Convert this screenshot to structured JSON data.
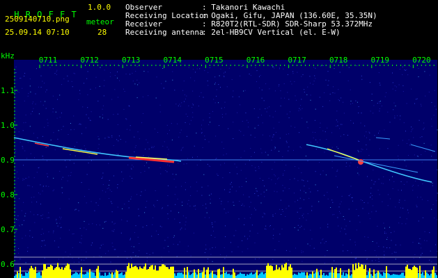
{
  "app": {
    "name": "H R O F F T",
    "version": "1.0.0",
    "filename": "2509140710.png",
    "datetime": "25.09.14 07:10",
    "meteor_label": "meteor",
    "meteor_count": "28"
  },
  "info": [
    {
      "label": "Observer",
      "value": ": Takanori Kawachi"
    },
    {
      "label": "Receiving Location",
      "value": ": Ogaki, Gifu, JAPAN (136.60E, 35.35N)"
    },
    {
      "label": "Receiver",
      "value": ": R820T2(RTL-SDR) SDR-Sharp 53.372MHz"
    },
    {
      "label": "Receiving antenna",
      "value": ": 2el-HB9CV Vertical (el. E-W)"
    }
  ],
  "chart_data": {
    "type": "heatmap",
    "ylabel": "kHz",
    "x_ticks": [
      "0711",
      "0712",
      "0713",
      "0714",
      "0715",
      "0716",
      "0717",
      "0718",
      "0719",
      "0720"
    ],
    "y_ticks": [
      "1.1",
      "1.0",
      "0.9",
      "0.8",
      "0.7",
      "0.6"
    ],
    "ylim": [
      0.6,
      1.15
    ],
    "carrier_khz": 0.9,
    "colors": {
      "background": "#00006a",
      "text": "#00ff00",
      "activity_bar": "#ffff00",
      "baseline_bar": "#00c8ff"
    }
  }
}
